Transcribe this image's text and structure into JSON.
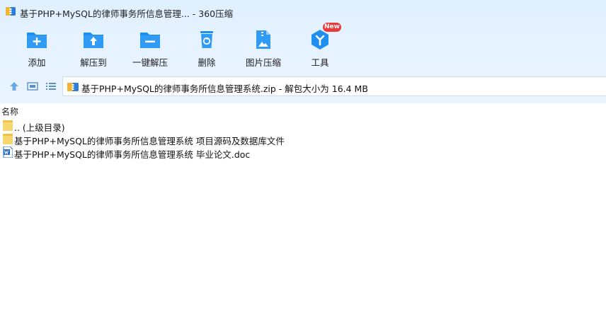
{
  "window": {
    "title": "基于PHP+MySQL的律师事务所信息管理... - 360压缩"
  },
  "toolbar": {
    "items": [
      {
        "label": "添加",
        "icon": "add-folder-icon"
      },
      {
        "label": "解压到",
        "icon": "extract-to-icon"
      },
      {
        "label": "一键解压",
        "icon": "one-click-extract-icon"
      },
      {
        "label": "删除",
        "icon": "trash-icon"
      },
      {
        "label": "图片压缩",
        "icon": "image-compress-icon"
      },
      {
        "label": "工具",
        "icon": "tools-icon",
        "badge": "New"
      }
    ]
  },
  "nav": {
    "path": "基于PHP+MySQL的律师事务所信息管理系统.zip - 解包大小为 16.4 MB"
  },
  "list": {
    "column_name": "名称",
    "rows": [
      {
        "name": ".. (上级目录)",
        "icon": "folder-icon"
      },
      {
        "name": "基于PHP+MySQL的律师事务所信息管理系统 项目源码及数据库文件",
        "icon": "folder-icon"
      },
      {
        "name": "基于PHP+MySQL的律师事务所信息管理系统 毕业论文.doc",
        "icon": "word-doc-icon"
      }
    ]
  },
  "colors": {
    "accent": "#1e8ef0",
    "folder": "#f7d66e",
    "badge": "#e83a3a"
  }
}
